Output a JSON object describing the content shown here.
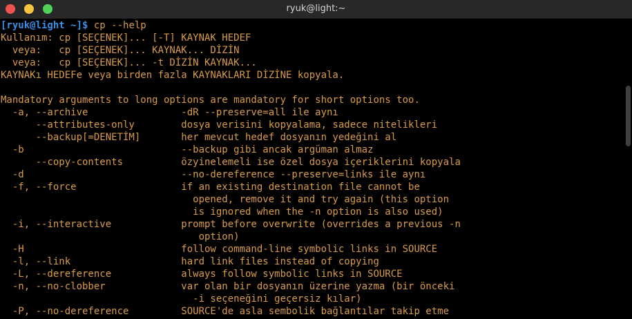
{
  "window": {
    "title": "ryuk@light:~"
  },
  "prompt": {
    "text": "[ryuk@light ~]$",
    "command": "cp --help"
  },
  "lines": [
    "Kullanım: cp [SEÇENEK]... [-T] KAYNAK HEDEF",
    "  veya:   cp [SEÇENEK]... KAYNAK... DİZİN",
    "  veya:   cp [SEÇENEK]... -t DİZİN KAYNAK...",
    "KAYNAKı HEDEFe veya birden fazla KAYNAKLARI DİZİNE kopyala.",
    "",
    "Mandatory arguments to long options are mandatory for short options too.",
    "  -a, --archive                -dR --preserve=all ile aynı",
    "      --attributes-only        dosya verisini kopyalama, sadece nitelikleri",
    "      --backup[=DENETİM]       her mevcut hedef dosyanın yedeğini al",
    "  -b                           --backup gibi ancak argüman almaz",
    "      --copy-contents          özyinelemeli ise özel dosya içeriklerini kopyala",
    "  -d                           --no-dereference --preserve=links ile aynı",
    "  -f, --force                  if an existing destination file cannot be",
    "                                 opened, remove it and try again (this option",
    "                                 is ignored when the -n option is also used)",
    "  -i, --interactive            prompt before overwrite (overrides a previous -n",
    "                                  option)",
    "  -H                           follow command-line symbolic links in SOURCE",
    "  -l, --link                   hard link files instead of copying",
    "  -L, --dereference            always follow symbolic links in SOURCE",
    "  -n, --no-clobber             var olan bir dosyanın üzerine yazma (bir önceki",
    "                                 -i seçeneğini geçersiz kılar)",
    "  -P, --no-dereference         SOURCE'de asla sembolik bağlantılar takip etme"
  ],
  "colors": {
    "background": "#000000",
    "text": "#d89b48",
    "prompt": "#3a8ee6",
    "titlebar": "#282828"
  }
}
